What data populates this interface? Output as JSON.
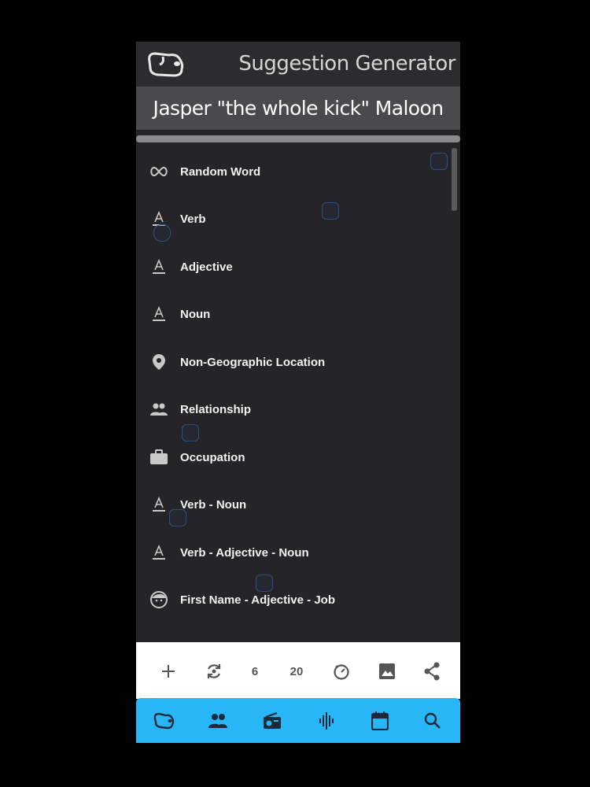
{
  "header": {
    "title": "Suggestion Generator",
    "logo_icon": "dog-face-icon"
  },
  "suggestion": {
    "text": "Jasper \"the whole kick\" Maloon"
  },
  "list": {
    "items": [
      {
        "label": "Random Word",
        "icon": "infinity-icon"
      },
      {
        "label": "Verb",
        "icon": "text-format-icon"
      },
      {
        "label": "Adjective",
        "icon": "text-format-icon"
      },
      {
        "label": "Noun",
        "icon": "text-format-icon"
      },
      {
        "label": "Non-Geographic Location",
        "icon": "location-pin-icon"
      },
      {
        "label": "Relationship",
        "icon": "people-icon"
      },
      {
        "label": "Occupation",
        "icon": "briefcase-icon"
      },
      {
        "label": "Verb - Noun",
        "icon": "text-format-icon"
      },
      {
        "label": "Verb - Adjective - Noun",
        "icon": "text-format-icon"
      },
      {
        "label": "First Name - Adjective - Job",
        "icon": "face-icon"
      }
    ]
  },
  "toolbar": {
    "count_a": "6",
    "count_b": "20"
  },
  "colors": {
    "accent": "#29b6f6",
    "background": "#252527",
    "header": "#2c2c2e"
  }
}
